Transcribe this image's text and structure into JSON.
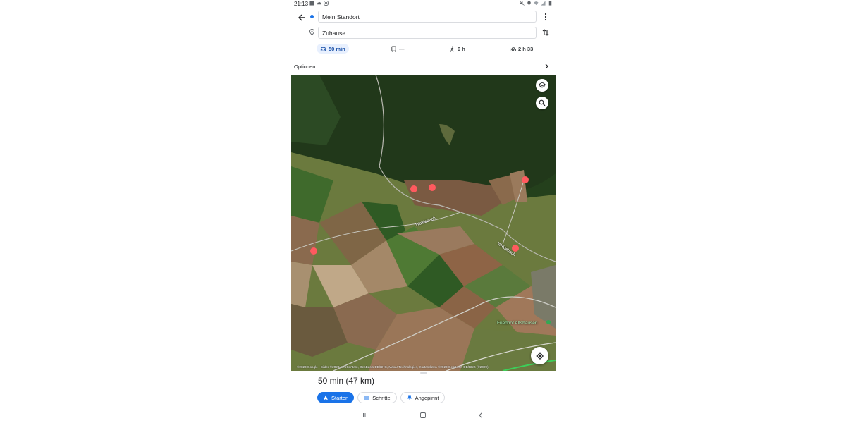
{
  "status_bar": {
    "time": "21:13",
    "left_icons": [
      "image-icon",
      "cloud-icon",
      "instagram-icon"
    ],
    "right_icons": [
      "mute-icon",
      "location-icon",
      "wifi-icon",
      "signal-icon",
      "battery-icon"
    ]
  },
  "directions": {
    "origin": "Mein Standort",
    "destination": "Zuhause"
  },
  "modes": [
    {
      "name": "car",
      "icon": "car-icon",
      "value": "50 min",
      "active": true
    },
    {
      "name": "transit",
      "icon": "transit-icon",
      "value": "—",
      "active": false
    },
    {
      "name": "walk",
      "icon": "walk-icon",
      "value": "9 h",
      "active": false
    },
    {
      "name": "bike",
      "icon": "bike-icon",
      "value": "2 h 33",
      "active": false
    }
  ],
  "options": {
    "label": "Optionen"
  },
  "map": {
    "labels": {
      "stream_1": "Waldebach",
      "stream_2": "Waldebach",
      "poi": "Friedhof Altshausen"
    },
    "attribution": "©2023 Google · Bilder ©2023 GeoContent, GeoBasis-DE/BKG, Maxar Technologies, Kartendaten ©2023 GeoBasis-DE/BKG (©2009)",
    "colors": {
      "forest": "#24401c",
      "field_brown": "#8a6a4e",
      "field_green": "#3f6a2c",
      "pin_red": "#ff5a5f",
      "road": "#c8c8c8"
    }
  },
  "summary": {
    "text": "50 min  (47 km)"
  },
  "actions": [
    {
      "label": "Starten",
      "icon": "navigation-arrow-icon"
    },
    {
      "label": "Schritte",
      "icon": "list-icon"
    },
    {
      "label": "Angepinnt",
      "icon": "pin-icon"
    }
  ],
  "accent_color": "#1a73e8"
}
